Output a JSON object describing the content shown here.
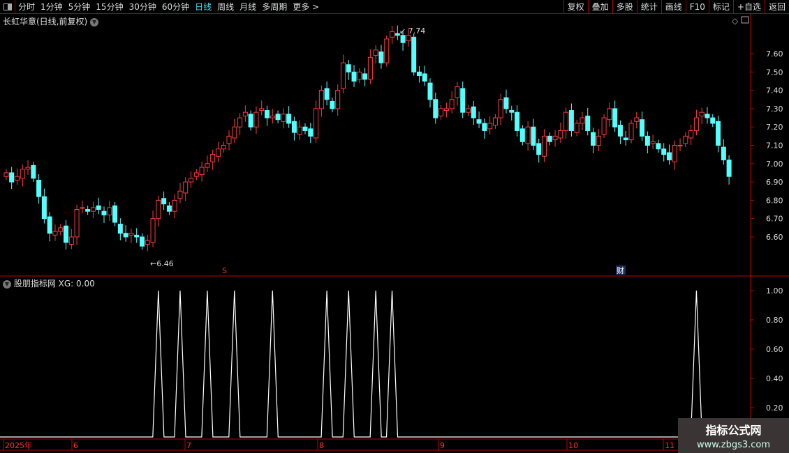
{
  "toolbar": {
    "periods": [
      "分时",
      "1分钟",
      "5分钟",
      "15分钟",
      "30分钟",
      "60分钟",
      "日线",
      "周线",
      "月线",
      "多周期",
      "更多 >"
    ],
    "active": "日线",
    "right_buttons": [
      "复权",
      "叠加",
      "多股",
      "统计",
      "画线",
      "F10",
      "标记",
      "+自选",
      "返回"
    ]
  },
  "main": {
    "title": "长虹华意(日线,前复权)",
    "high_label": "7.74",
    "low_label": "6.46",
    "s_marker": "S",
    "cai_marker": "财"
  },
  "indicator": {
    "title": "股朋指标网 XG: 0.00"
  },
  "colors": {
    "up": "#ff3b3b",
    "down": "#54ffff",
    "axis": "#c00000",
    "signal": "#ffffff"
  },
  "chart_data": [
    {
      "type": "candlestick",
      "yaxis_ticks": [
        "7.60",
        "7.50",
        "7.40",
        "7.30",
        "7.20",
        "7.10",
        "7.00",
        "6.90",
        "6.80",
        "6.70",
        "6.60"
      ],
      "ylim": [
        6.46,
        7.74
      ],
      "x_labels": [
        "2025年",
        "6",
        "7",
        "8",
        "9",
        "10",
        "11"
      ],
      "closes": [
        6.95,
        6.9,
        6.93,
        6.97,
        6.98,
        6.92,
        6.82,
        6.7,
        6.62,
        6.63,
        6.65,
        6.57,
        6.6,
        6.75,
        6.76,
        6.74,
        6.76,
        6.75,
        6.72,
        6.76,
        6.68,
        6.62,
        6.6,
        6.62,
        6.6,
        6.55,
        6.58,
        6.7,
        6.8,
        6.78,
        6.74,
        6.8,
        6.85,
        6.9,
        6.92,
        6.95,
        6.98,
        7.0,
        7.05,
        7.08,
        7.1,
        7.15,
        7.2,
        7.25,
        7.28,
        7.2,
        7.28,
        7.3,
        7.25,
        7.26,
        7.24,
        7.27,
        7.22,
        7.17,
        7.2,
        7.18,
        7.15,
        7.3,
        7.4,
        7.35,
        7.3,
        7.4,
        7.55,
        7.5,
        7.45,
        7.5,
        7.46,
        7.58,
        7.62,
        7.55,
        7.68,
        7.72,
        7.7,
        7.66,
        7.7,
        7.5,
        7.48,
        7.45,
        7.35,
        7.25,
        7.3,
        7.3,
        7.35,
        7.42,
        7.28,
        7.3,
        7.25,
        7.22,
        7.18,
        7.22,
        7.25,
        7.35,
        7.3,
        7.28,
        7.18,
        7.12,
        7.2,
        7.1,
        7.05,
        7.15,
        7.12,
        7.15,
        7.18,
        7.28,
        7.18,
        7.22,
        7.25,
        7.18,
        7.1,
        7.15,
        7.25,
        7.3,
        7.2,
        7.15,
        7.13,
        7.22,
        7.25,
        7.15,
        7.1,
        7.12,
        7.08,
        7.05,
        7.02,
        7.1,
        7.1,
        7.15,
        7.18,
        7.25,
        7.28,
        7.25,
        7.22,
        7.1,
        7.02,
        6.93
      ]
    },
    {
      "type": "line",
      "name": "XG",
      "yaxis_ticks": [
        "1.00",
        "0.80",
        "0.60",
        "0.40",
        "0.20"
      ],
      "ylim": [
        0,
        1
      ],
      "signal_bars": [
        28,
        32,
        37,
        42,
        49,
        59,
        63,
        68,
        71,
        127
      ]
    }
  ],
  "watermark": {
    "line1": "指标公式网",
    "line2": "www.zbgs3.com"
  }
}
